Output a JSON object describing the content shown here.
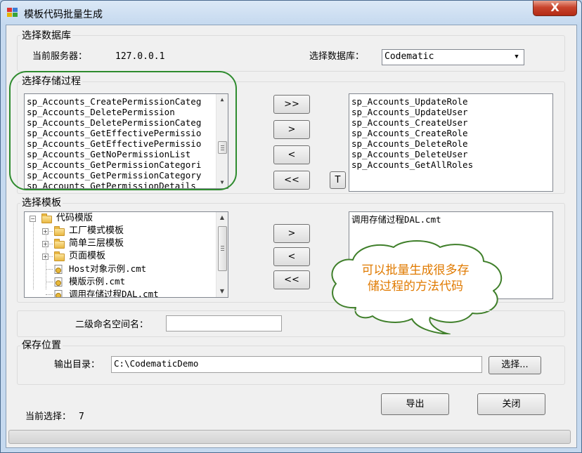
{
  "window": {
    "title": "模板代码批量生成",
    "close_label": "X"
  },
  "db_group": {
    "title": "选择数据库",
    "server_label": "当前服务器：",
    "server_value": "127.0.0.1",
    "database_label": "选择数据库：",
    "database_value": "Codematic"
  },
  "proc_group": {
    "title": "选择存储过程",
    "available": [
      "sp_Accounts_CreatePermissionCateg",
      "sp_Accounts_DeletePermission",
      "sp_Accounts_DeletePermissionCateg",
      "sp_Accounts_GetEffectivePermissio",
      "sp_Accounts_GetEffectivePermissio",
      "sp_Accounts_GetNoPermissionList",
      "sp_Accounts_GetPermissionCategori",
      "sp_Accounts_GetPermissionCategory",
      "sp_Accounts_GetPermissionDetails"
    ],
    "selected": [
      "sp_Accounts_UpdateRole",
      "sp_Accounts_UpdateUser",
      "sp_Accounts_CreateUser",
      "sp_Accounts_CreateRole",
      "sp_Accounts_DeleteRole",
      "sp_Accounts_DeleteUser",
      "sp_Accounts_GetAllRoles"
    ],
    "btn_add_all": ">>",
    "btn_add": ">",
    "btn_remove": "<",
    "btn_remove_all": "<<",
    "btn_t": "T"
  },
  "template_group": {
    "title": "选择模板",
    "tree": {
      "root": "代码模版",
      "folders": [
        "工厂模式模板",
        "简单三层模板",
        "页面模板"
      ],
      "files": [
        "Host对象示例.cmt",
        "模版示例.cmt",
        "调用存储过程DAL.cmt"
      ]
    },
    "selected": [
      "调用存储过程DAL.cmt"
    ],
    "btn_add": ">",
    "btn_remove": "<",
    "btn_remove_all": "<<"
  },
  "callout": {
    "line1": "可以批量生成很多存",
    "line2": "储过程的方法代码"
  },
  "namespace": {
    "label": "二级命名空间名：",
    "value": ""
  },
  "save_group": {
    "title": "保存位置",
    "output_label": "输出目录：",
    "output_value": "C:\\CodematicDemo",
    "browse_label": "选择..."
  },
  "actions": {
    "export_label": "导出",
    "close_label": "关闭"
  },
  "status": {
    "current_label": "当前选择：",
    "current_value": "7"
  },
  "progress": {
    "value": 0
  },
  "colors": {
    "highlight_ring": "#2e8b2e",
    "callout_border": "#3f7f2a",
    "callout_text": "#e07a00"
  }
}
